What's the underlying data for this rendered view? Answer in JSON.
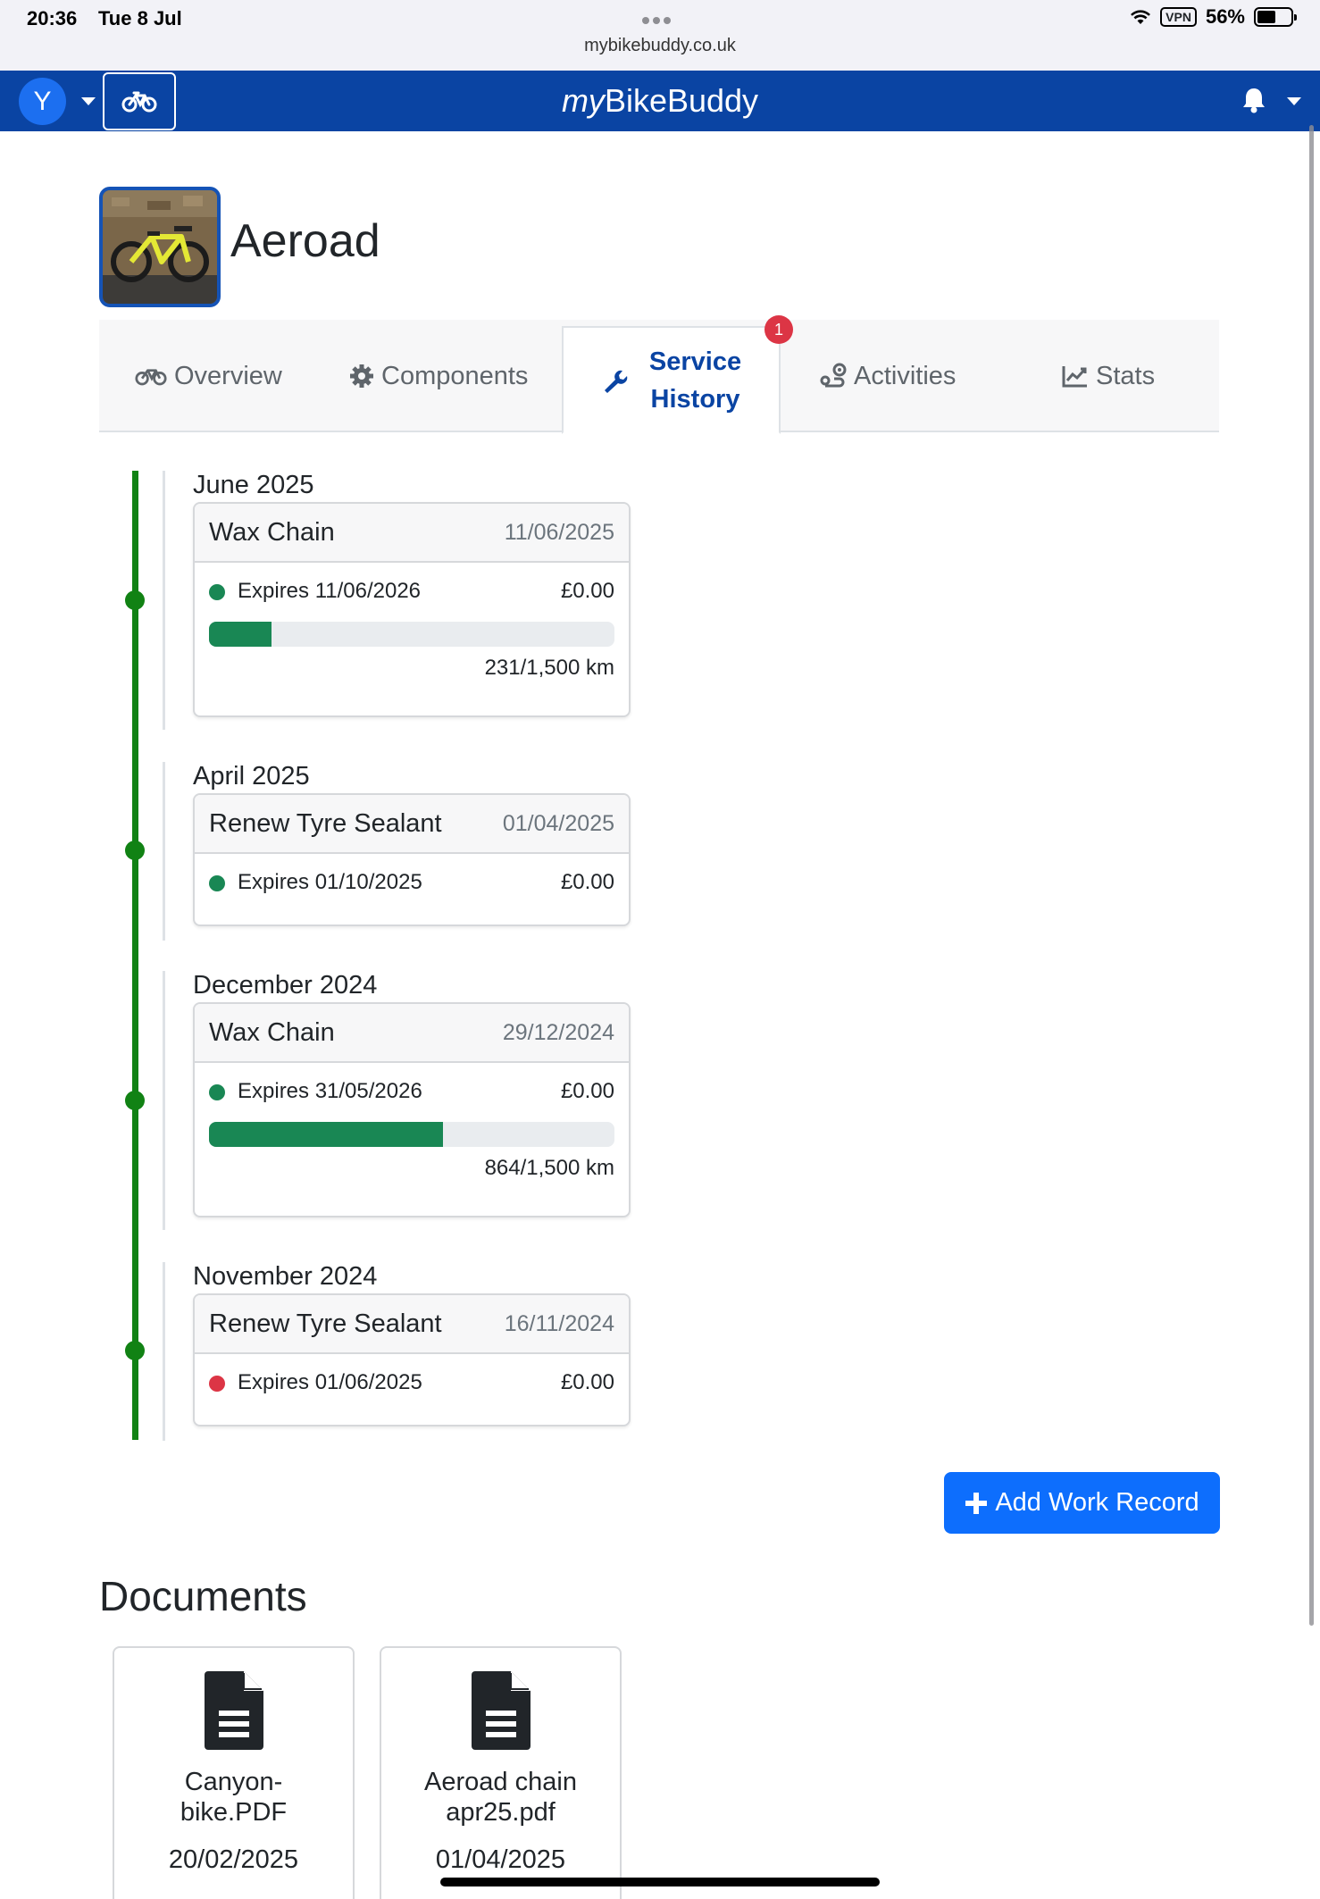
{
  "status_bar": {
    "time": "20:36",
    "date": "Tue 8 Jul",
    "url": "mybikebuddy.co.uk",
    "vpn": "VPN",
    "battery": "56%",
    "battery_level": 0.56
  },
  "navbar": {
    "avatar_initial": "Y",
    "brand_prefix": "my",
    "brand_suffix": "BikeBuddy"
  },
  "bike": {
    "name": "Aeroad"
  },
  "tabs": [
    {
      "label": "Overview",
      "icon": "bicycle-icon"
    },
    {
      "label": "Components",
      "icon": "gear-icon"
    },
    {
      "label_line1": "Service",
      "label_line2": "History",
      "icon": "wrench-icon",
      "badge": "1"
    },
    {
      "label": "Activities",
      "icon": "route-icon"
    },
    {
      "label": "Stats",
      "icon": "chart-line-icon"
    }
  ],
  "service_history": [
    {
      "month": "June 2025",
      "title": "Wax Chain",
      "date": "11/06/2025",
      "expires": "Expires 11/06/2026",
      "cost": "£0.00",
      "status": "green",
      "progress": 0.154,
      "distance": "231/1,500 km"
    },
    {
      "month": "April 2025",
      "title": "Renew Tyre Sealant",
      "date": "01/04/2025",
      "expires": "Expires 01/10/2025",
      "cost": "£0.00",
      "status": "green"
    },
    {
      "month": "December 2024",
      "title": "Wax Chain",
      "date": "29/12/2024",
      "expires": "Expires 31/05/2026",
      "cost": "£0.00",
      "status": "green",
      "progress": 0.576,
      "distance": "864/1,500 km"
    },
    {
      "month": "November 2024",
      "title": "Renew Tyre Sealant",
      "date": "16/11/2024",
      "expires": "Expires 01/06/2025",
      "cost": "£0.00",
      "status": "red"
    }
  ],
  "add_button": {
    "label": "Add Work Record"
  },
  "documents": {
    "title": "Documents",
    "items": [
      {
        "name_line1": "Canyon-",
        "name_line2": "bike.PDF",
        "date": "20/02/2025"
      },
      {
        "name_line1": "Aeroad chain",
        "name_line2": "apr25.pdf",
        "date": "01/04/2025"
      }
    ]
  },
  "colors": {
    "navbar": "#0a44a3",
    "primary": "#0d6efd",
    "success": "#198754",
    "danger": "#dc3545",
    "timeline": "#118214"
  }
}
